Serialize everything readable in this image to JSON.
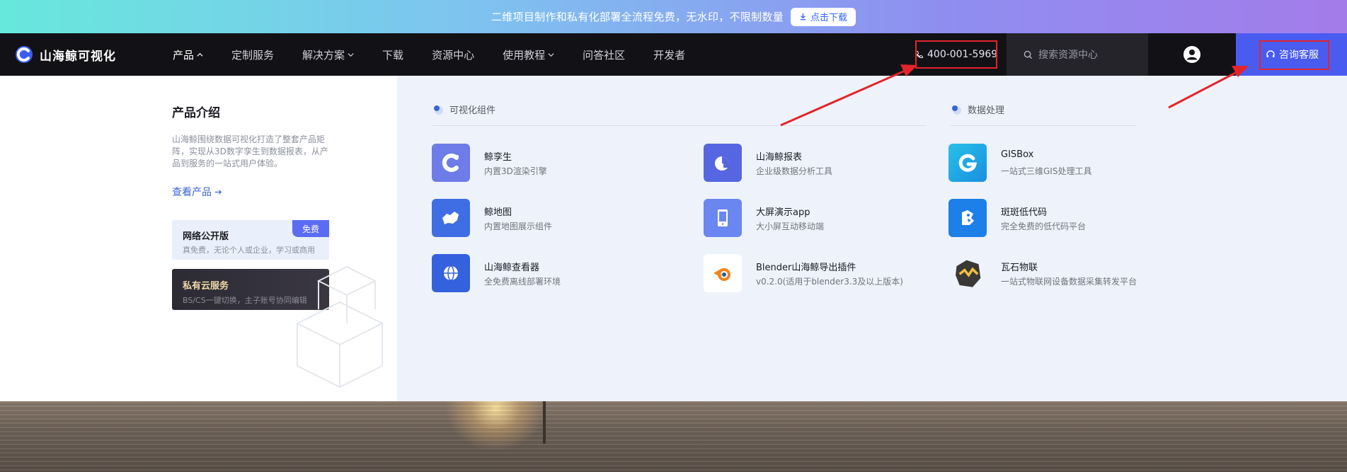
{
  "banner": {
    "text": "二维项目制作和私有化部署全流程免费，无水印，不限制数量",
    "button": "点击下载"
  },
  "nav": {
    "logo": "山海鲸可视化",
    "menu": [
      {
        "label": "产品"
      },
      {
        "label": "定制服务"
      },
      {
        "label": "解决方案"
      },
      {
        "label": "下载"
      },
      {
        "label": "资源中心"
      },
      {
        "label": "使用教程"
      },
      {
        "label": "问答社区"
      },
      {
        "label": "开发者"
      }
    ],
    "phone": "400-001-5969",
    "search_placeholder": "搜索资源中心",
    "consult": "咨询客服"
  },
  "intro": {
    "title": "产品介绍",
    "desc": "山海鲸围绕数据可视化打造了整套产品矩阵，实现从3D数字孪生到数据报表，从产品到服务的一站式用户体验。",
    "link": "查看产品",
    "public_card": {
      "title": "网络公开版",
      "sub": "真免费，无论个人或企业，学习或商用",
      "badge": "免费"
    },
    "private_card": {
      "title": "私有云服务",
      "sub": "BS/CS一键切换，主子账号协同编辑"
    }
  },
  "sections": {
    "viz": "可视化组件",
    "data": "数据处理"
  },
  "products": [
    {
      "title": "鲸孪生",
      "sub": "内置3D渲染引擎"
    },
    {
      "title": "山海鲸报表",
      "sub": "企业级数据分析工具"
    },
    {
      "title": "GISBox",
      "sub": "一站式三维GIS处理工具"
    },
    {
      "title": "鲸地图",
      "sub": "内置地图展示组件"
    },
    {
      "title": "大屏演示app",
      "sub": "大小屏互动移动端"
    },
    {
      "title": "斑斑低代码",
      "sub": "完全免费的低代码平台"
    },
    {
      "title": "山海鲸查看器",
      "sub": "全免费离线部署环境"
    },
    {
      "title": "Blender山海鲸导出插件",
      "sub": "v0.2.0(适用于blender3.3及以上版本)"
    },
    {
      "title": "瓦石物联",
      "sub": "一站式物联网设备数据采集转发平台"
    }
  ],
  "colors": {
    "nav_bg": "#121216",
    "accent": "#4a5cf0",
    "annotation": "#e3242b",
    "panel_bg": "#eef3fb"
  }
}
